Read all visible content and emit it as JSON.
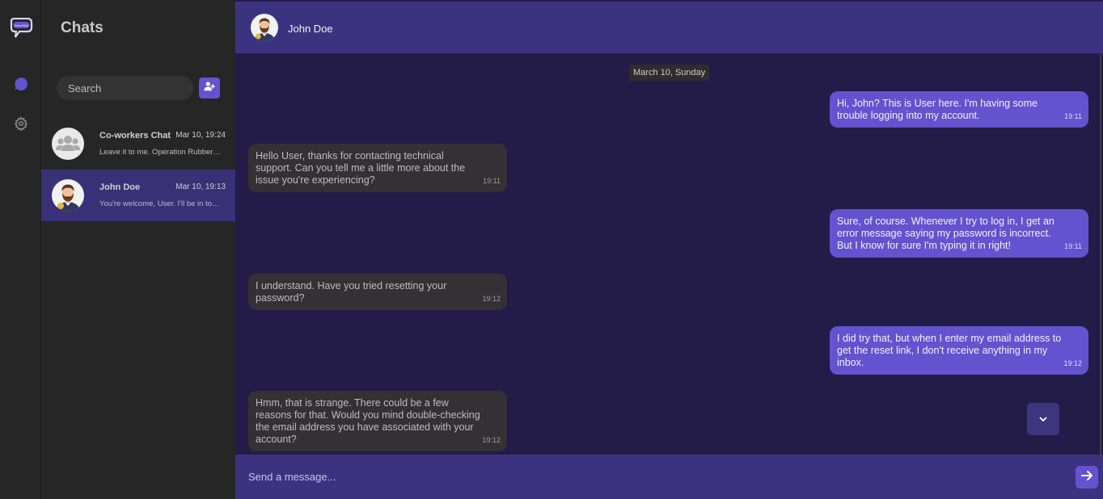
{
  "rail": {
    "logo_text": "SmartTalk",
    "items": [
      {
        "icon": "chat-bubble-icon",
        "active": true
      },
      {
        "icon": "gear-icon",
        "active": false
      }
    ]
  },
  "sidebar": {
    "title": "Chats",
    "search_placeholder": "Search",
    "chats": [
      {
        "name": "Co-workers Chat",
        "time": "Mar 10, 19:24",
        "preview": "Leave it to me. Operation Rubber Duck is a go.",
        "avatar": "group-avatar-icon",
        "active": false
      },
      {
        "name": "John Doe",
        "time": "Mar 10, 19:13",
        "preview": "You're welcome, User. I'll be in touch.",
        "avatar": "john-avatar",
        "active": true
      }
    ]
  },
  "conversation": {
    "contact_name": "John Doe",
    "date_label": "March 10, Sunday",
    "messages": [
      {
        "direction": "out",
        "text": "Hi, John? This is User here. I'm having some trouble logging into my account.",
        "time": "19:11"
      },
      {
        "direction": "in",
        "text": "Hello User, thanks for contacting technical support. Can you tell me a little more about the issue you're experiencing?",
        "time": "19:11"
      },
      {
        "direction": "out",
        "text": "Sure, of course. Whenever I try to log in, I get an error message saying my password is incorrect. But I know for sure I'm typing it in right!",
        "time": "19:11"
      },
      {
        "direction": "in",
        "text": "I understand. Have you tried resetting your password?",
        "time": "19:12"
      },
      {
        "direction": "out",
        "text": "I did try that, but when I enter my email address to get the reset link, I don't receive anything in my inbox.",
        "time": "19:12"
      },
      {
        "direction": "in",
        "text": "Hmm, that is strange. There could be a few reasons for that. Would you mind double-checking the email address you have associated with your account?",
        "time": "19:12"
      }
    ],
    "composer_placeholder": "Send a message..."
  },
  "colors": {
    "accent": "#6452cf",
    "header": "#3c3380",
    "chat_bg": "#231b48",
    "incoming_bubble": "#333133",
    "sidebar_bg": "#262626"
  }
}
